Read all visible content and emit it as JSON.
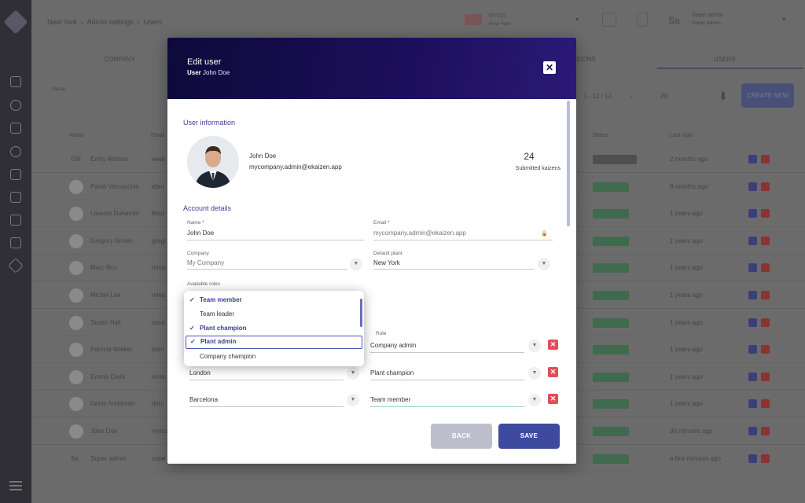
{
  "background": {
    "breadcrumb": [
      "New York",
      "Admin settings",
      "Users"
    ],
    "plant": {
      "code": "NYC01",
      "name": "New York"
    },
    "user_menu": {
      "initials": "Sa",
      "name": "Super admin",
      "sub": "Super admin"
    },
    "tabs": [
      "COMPANY",
      "SIONS",
      "USERS"
    ],
    "search_placeholder": "Name",
    "pagination": "1 - 12 / 12",
    "per_page": "20",
    "create_label": "CREATE NEW",
    "columns": [
      "Name",
      "Email",
      "Status",
      "Last login"
    ],
    "rows": [
      {
        "initials": "EW",
        "name": "Emily Watson",
        "email": "ewat",
        "last": "2 months ago"
      },
      {
        "initials": "",
        "name": "Paolo Vercocchio",
        "email": "ebro",
        "last": "8 months ago"
      },
      {
        "initials": "",
        "name": "Laurent Duhamel",
        "email": "lbrut",
        "last": "1 years ago"
      },
      {
        "initials": "",
        "name": "Gregory Brown",
        "email": "gregi",
        "last": "1 years ago"
      },
      {
        "initials": "",
        "name": "Marc Roy",
        "email": "mroy",
        "last": "1 years ago"
      },
      {
        "initials": "",
        "name": "Michel Lea",
        "email": "mlea",
        "last": "1 years ago"
      },
      {
        "initials": "",
        "name": "Susan Hall",
        "email": "susa",
        "last": "1 years ago"
      },
      {
        "initials": "",
        "name": "Patricia Walker",
        "email": "patri",
        "last": "1 years ago"
      },
      {
        "initials": "",
        "name": "Emma Clark",
        "email": "emm",
        "last": "1 years ago"
      },
      {
        "initials": "",
        "name": "Denis Anderson",
        "email": "deni",
        "last": "1 years ago"
      },
      {
        "initials": "",
        "name": "John Doe",
        "email": "myco",
        "last": "36 minutes ago"
      },
      {
        "initials": "Sa",
        "name": "Super admin",
        "email": "supe",
        "last": "a few minutes ago"
      }
    ]
  },
  "modal": {
    "title": "Edit user",
    "subtitle_label": "User",
    "subtitle_value": "John Doe",
    "close_icon": "close-icon",
    "user_info_title": "User information",
    "user": {
      "name": "John Doe",
      "email": "mycompany.admin@ekaizen.app"
    },
    "kaizens": {
      "count": "24",
      "label": "Submitted kaizens"
    },
    "account_title": "Account details",
    "fields": {
      "name": {
        "label": "Name *",
        "value": "John Doe"
      },
      "email": {
        "label": "Email *",
        "value": "mycompany.admin@ekaizen.app"
      },
      "company": {
        "label": "Company",
        "value": "My Company"
      },
      "default_plant": {
        "label": "Default plant",
        "value": "New York"
      },
      "roles": {
        "label": "Available roles"
      }
    },
    "role_column_label": "Role",
    "plant_roles": [
      {
        "plant": "",
        "role": "Company admin"
      },
      {
        "plant": "London",
        "role": "Plant champion"
      },
      {
        "plant": "Barcelona",
        "role": "Team member"
      }
    ],
    "back_label": "BACK",
    "save_label": "SAVE"
  },
  "roles_dropdown": [
    {
      "label": "Team member",
      "selected": true
    },
    {
      "label": "Team leader",
      "selected": false
    },
    {
      "label": "Plant champion",
      "selected": true
    },
    {
      "label": "Plant admin",
      "selected": true
    },
    {
      "label": "Company champion",
      "selected": false
    }
  ],
  "colors": {
    "accent": "#3e4a9e",
    "header_dark": "#0d0a3a",
    "danger": "#e54b5b"
  }
}
